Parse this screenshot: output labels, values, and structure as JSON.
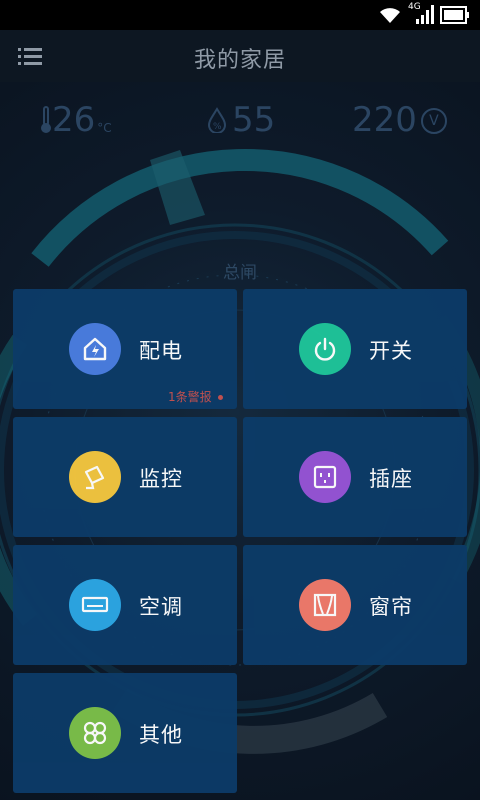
{
  "status_bar": {
    "network": "4G"
  },
  "app_bar": {
    "title": "我的家居",
    "menu_icon": "menu-icon"
  },
  "metrics": {
    "temperature": {
      "value": "26",
      "unit": "°C",
      "icon": "thermometer-icon"
    },
    "humidity": {
      "value": "55",
      "icon": "water-drop-icon"
    },
    "voltage": {
      "value": "220",
      "unit": "V",
      "icon": "volt-icon"
    }
  },
  "gauge": {
    "label": "总闸"
  },
  "alarm": {
    "text": "1条警报"
  },
  "tiles": [
    {
      "label": "配电",
      "icon": "power-distribution-icon",
      "color": "#4a7de0"
    },
    {
      "label": "开关",
      "icon": "power-switch-icon",
      "color": "#1fc59a"
    },
    {
      "label": "监控",
      "icon": "camera-icon",
      "color": "#f3c63f"
    },
    {
      "label": "插座",
      "icon": "socket-icon",
      "color": "#9754d6"
    },
    {
      "label": "空调",
      "icon": "air-conditioner-icon",
      "color": "#2ca7e4"
    },
    {
      "label": "窗帘",
      "icon": "curtain-icon",
      "color": "#f17a6b"
    },
    {
      "label": "其他",
      "icon": "grid-icon",
      "color": "#7cc04a"
    }
  ]
}
